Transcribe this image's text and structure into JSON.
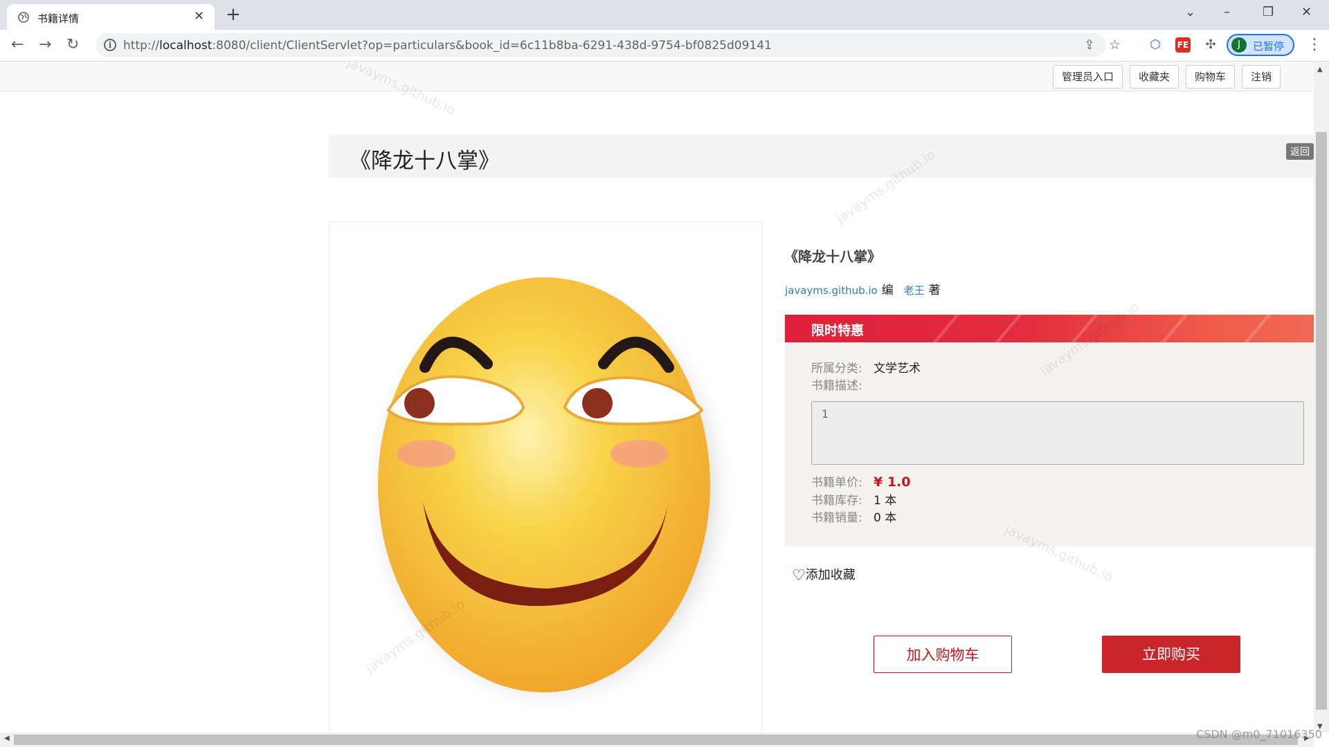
{
  "browser": {
    "tab_title": "书籍详情",
    "tab_close": "✕",
    "new_tab": "+",
    "url_scheme": "http://",
    "url_host": "localhost",
    "url_rest": ":8080/client/ClientServlet?op=particulars&book_id=6c11b8ba-6291-438d-9754-bf0825d09141",
    "profile_initial": "J",
    "profile_status": "已暂停",
    "ext_label": "FE"
  },
  "nav": {
    "admin": "管理员入口",
    "favorites": "收藏夹",
    "cart": "购物车",
    "logout": "注销"
  },
  "book": {
    "page_title": "《降龙十八掌》",
    "return_label": "返回",
    "title": "《降龙十八掌》",
    "editor": "javayms.github.io",
    "editor_role": "编",
    "author": "老王",
    "author_role": "著",
    "promo_label": "限时特惠",
    "category_label": "所属分类:",
    "category": "文学艺术",
    "description_label": "书籍描述:",
    "description": "1",
    "price_label": "书籍单价:",
    "price": "¥ 1.0",
    "stock_label": "书籍库存:",
    "stock": "1 本",
    "sales_label": "书籍销量:",
    "sales": "0 本"
  },
  "actions": {
    "favorite": "添加收藏",
    "add_to_cart": "加入购物车",
    "buy_now": "立即购买"
  },
  "watermark": "javayms.github.io",
  "corner_mark": "CSDN @m0_71016350",
  "colors": {
    "accent_red": "#c9252a",
    "promo_red": "#e0203c",
    "link_blue": "#337ab7",
    "chrome_bar": "#dee1e6"
  }
}
